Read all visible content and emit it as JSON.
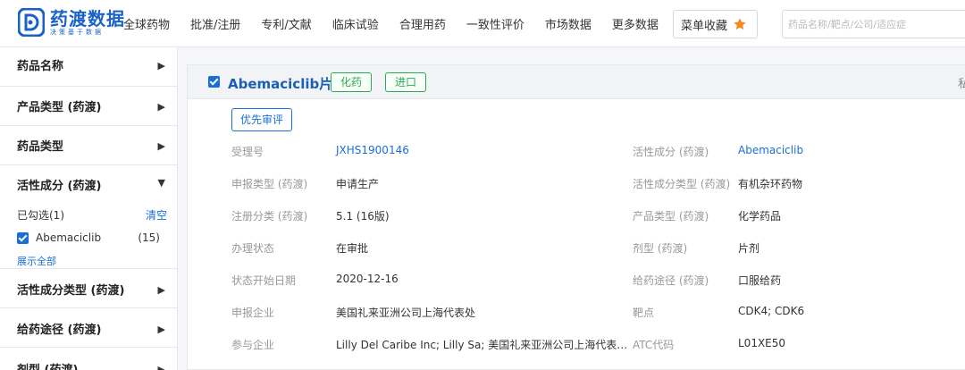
{
  "logo": {
    "title": "药渡数据",
    "subtitle": "决策基于数据"
  },
  "nav": [
    "全球药物",
    "批准/注册",
    "专利/文献",
    "临床试验",
    "合理用药",
    "一致性评价",
    "市场数据",
    "更多数据"
  ],
  "favorites_label": "菜单收藏",
  "search": {
    "placeholder": "药品名称/靶点/公司/适应症"
  },
  "colors": {
    "brand": "#1a61c8",
    "link": "#1a6fd6",
    "tag_green": "#2fa84f",
    "star": "#f5871f"
  },
  "sidebar": {
    "filters": [
      "药品名称",
      "产品类型 (药渡)",
      "药品类型",
      "活性成分 (药渡)",
      "活性成分类型 (药渡)",
      "给药途径 (药渡)",
      "剂型 (药渡)"
    ],
    "selected_text": "已勾选(1)",
    "clear_label": "清空",
    "checked_item": {
      "label": "Abemaciclib",
      "count": "(15)"
    },
    "show_all_label": "展示全部"
  },
  "record": {
    "title": "Abemaciclib片",
    "tags": [
      "化药",
      "进口"
    ],
    "priority_tag": "优先审评",
    "head_cut": "私",
    "left_fields": [
      {
        "label": "受理号",
        "value": "JXHS1900146"
      },
      {
        "label": "申报类型 (药渡)",
        "value": "申请生产"
      },
      {
        "label": "注册分类 (药渡)",
        "value": "5.1 (16版)"
      },
      {
        "label": "办理状态",
        "value": "在审批"
      },
      {
        "label": "状态开始日期",
        "value": "2020-12-16"
      },
      {
        "label": "申报企业",
        "value": "美国礼来亚洲公司上海代表处"
      },
      {
        "label": "参与企业",
        "value": "Lilly Del Caribe Inc; Lilly Sa; 美国礼来亚洲公司上海代表…"
      }
    ],
    "right_fields": [
      {
        "label": "活性成分 (药渡)",
        "value": "Abemaciclib"
      },
      {
        "label": "活性成分类型 (药渡)",
        "value": "有机杂环药物"
      },
      {
        "label": "产品类型 (药渡)",
        "value": "化学药品"
      },
      {
        "label": "剂型 (药渡)",
        "value": "片剂"
      },
      {
        "label": "给药途径 (药渡)",
        "value": "口服给药"
      },
      {
        "label": "靶点",
        "value": "CDK4; CDK6"
      },
      {
        "label": "ATC代码",
        "value": "L01XE50"
      }
    ]
  }
}
